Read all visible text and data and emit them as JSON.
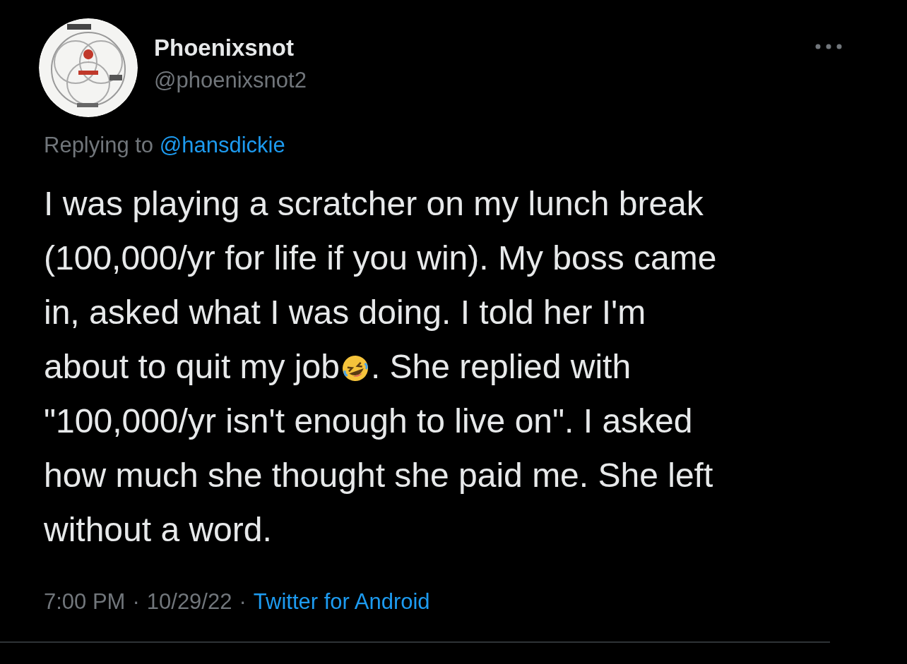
{
  "author": {
    "name": "Phoenixsnot",
    "handle": "@phoenixsnot2"
  },
  "reply_context": {
    "prefix": "Replying to",
    "mention": "@hansdickie"
  },
  "body": {
    "lines": [
      [
        {
          "kind": "text",
          "text": "I was playing a scratcher on my lunch break"
        }
      ],
      [
        {
          "kind": "text",
          "text": "(100,000/yr for life if you win). My boss came"
        }
      ],
      [
        {
          "kind": "text",
          "text": "in, asked what I was doing. I told her I'm"
        }
      ],
      [
        {
          "kind": "text",
          "text": "about to quit my job"
        },
        {
          "kind": "emoji"
        },
        {
          "kind": "text",
          "text": ". She replied with"
        }
      ],
      [
        {
          "kind": "text",
          "text": "\"100,000/yr isn't enough to live on\". I asked"
        }
      ],
      [
        {
          "kind": "text",
          "text": "how much she thought she paid me. She left"
        }
      ],
      [
        {
          "kind": "text",
          "text": "without a word."
        }
      ]
    ]
  },
  "meta": {
    "time": "7:00 PM",
    "separator": "·",
    "date": "10/29/22",
    "source": "Twitter for Android"
  }
}
